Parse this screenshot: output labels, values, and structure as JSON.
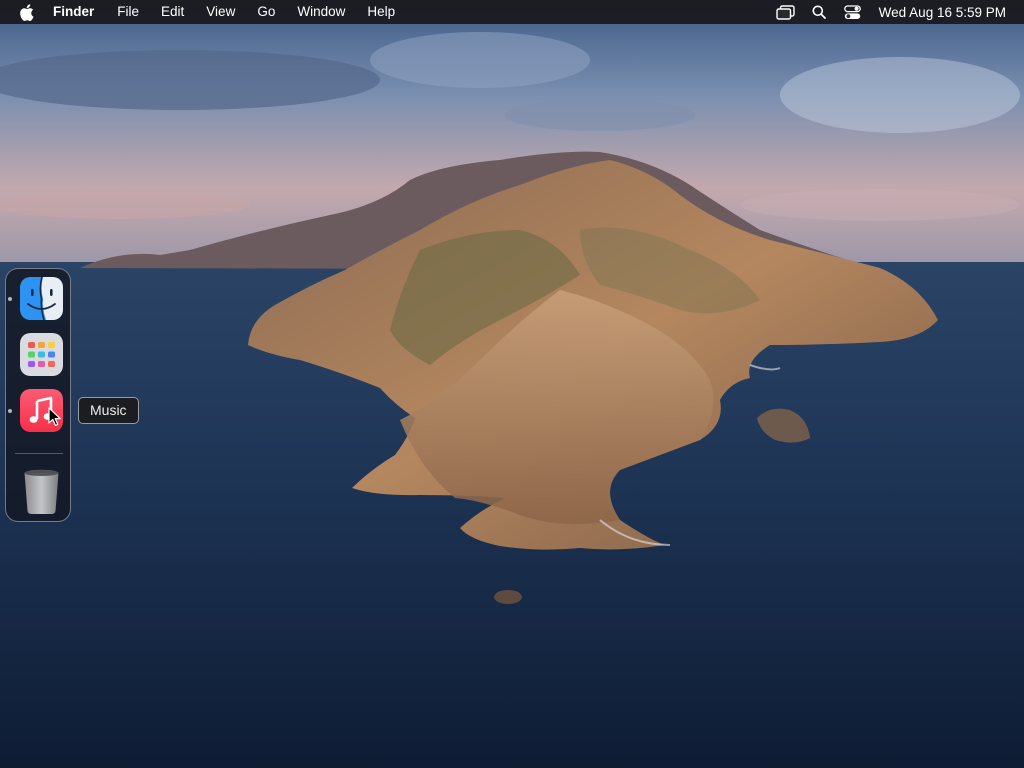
{
  "menubar": {
    "apple_icon": "apple-logo-icon",
    "app_name": "Finder",
    "menus": [
      "File",
      "Edit",
      "View",
      "Go",
      "Window",
      "Help"
    ],
    "status_icons": [
      "screen-mirroring-icon",
      "spotlight-search-icon",
      "control-center-icon"
    ],
    "clock": "Wed Aug 16  5:59 PM"
  },
  "dock": {
    "apps": [
      {
        "id": "finder",
        "icon": "finder-icon",
        "running": true
      },
      {
        "id": "launchpad",
        "icon": "launchpad-icon",
        "running": false
      },
      {
        "id": "music",
        "icon": "music-icon",
        "running": true
      },
      {
        "id": "trash",
        "icon": "trash-icon",
        "running": false
      }
    ],
    "tooltip": "Music"
  },
  "colors": {
    "menubar_bg": "#18181a",
    "music_red": "#fa3b53",
    "finder_blue": "#2c8ff0"
  }
}
